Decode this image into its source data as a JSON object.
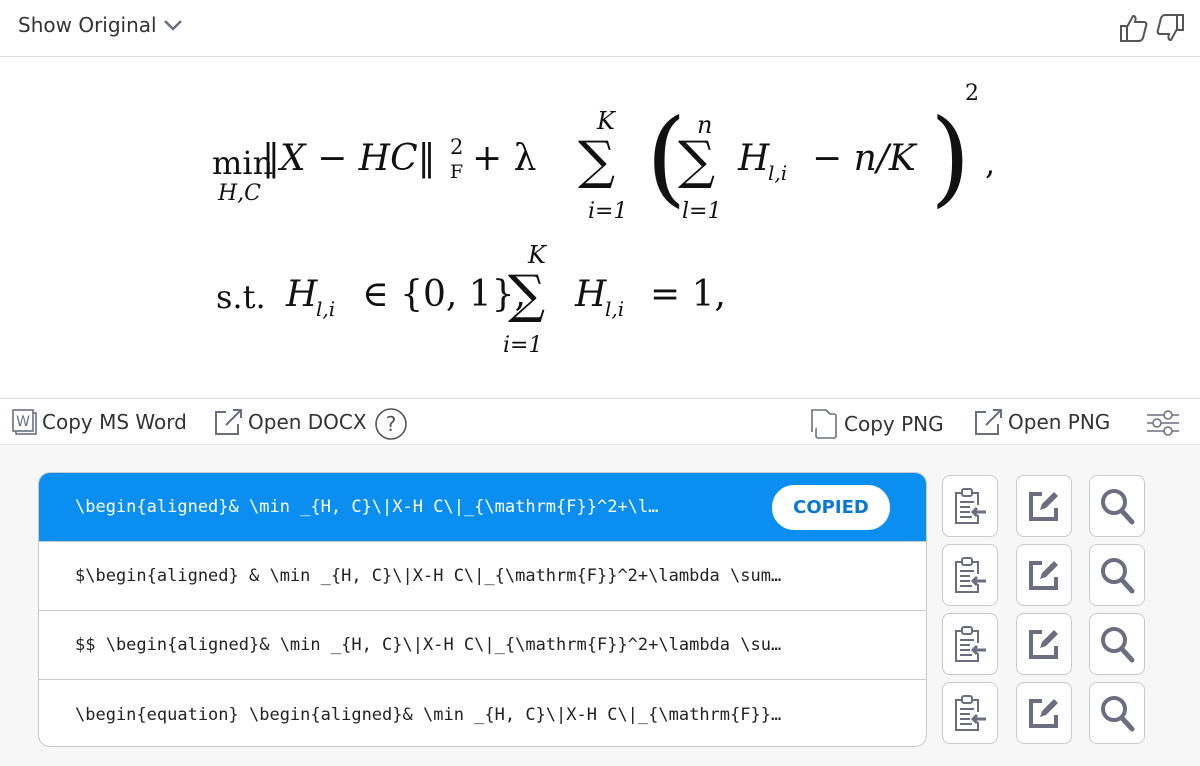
{
  "header": {
    "show_original": "Show Original"
  },
  "equation": {
    "min": "min",
    "min_sub": "H,C",
    "norm": "‖X − HC‖",
    "sq": "2",
    "frob": "F",
    "plus_lambda": "+ λ",
    "sigma": "∑",
    "K": "K",
    "i1": "i=1",
    "n": "n",
    "l1": "l=1",
    "lparen": "(",
    "rparen": ")",
    "inner": "H",
    "inner_sub": "l,i",
    "minus_nk": "− n/K",
    "outer_sq": "2",
    "comma": ",",
    "st": "s.t.",
    "H2": "H",
    "H2_sub": "l,i",
    "in_set": "∈ {0, 1},",
    "H3": "H",
    "H3_sub": "l,i",
    "eq_one": "= 1,"
  },
  "toolbar": {
    "copy_word": "Copy MS Word",
    "open_docx": "Open DOCX",
    "copy_png": "Copy PNG",
    "open_png": "Open PNG"
  },
  "results": [
    {
      "text": "\\begin{aligned}& \\min _{H, C}\\|X-H C\\|_{\\mathrm{F}}^2+\\l…",
      "badge": "COPIED"
    },
    {
      "text": "$\\begin{aligned} & \\min _{H, C}\\|X-H C\\|_{\\mathrm{F}}^2+\\lambda \\sum…"
    },
    {
      "text": "$$ \\begin{aligned}& \\min _{H, C}\\|X-H C\\|_{\\mathrm{F}}^2+\\lambda \\su…"
    },
    {
      "text": "\\begin{equation} \\begin{aligned}& \\min _{H, C}\\|X-H C\\|_{\\mathrm{F}}…"
    }
  ],
  "colors": {
    "accent": "#0a8ff0",
    "icon": "#6b6e80"
  }
}
